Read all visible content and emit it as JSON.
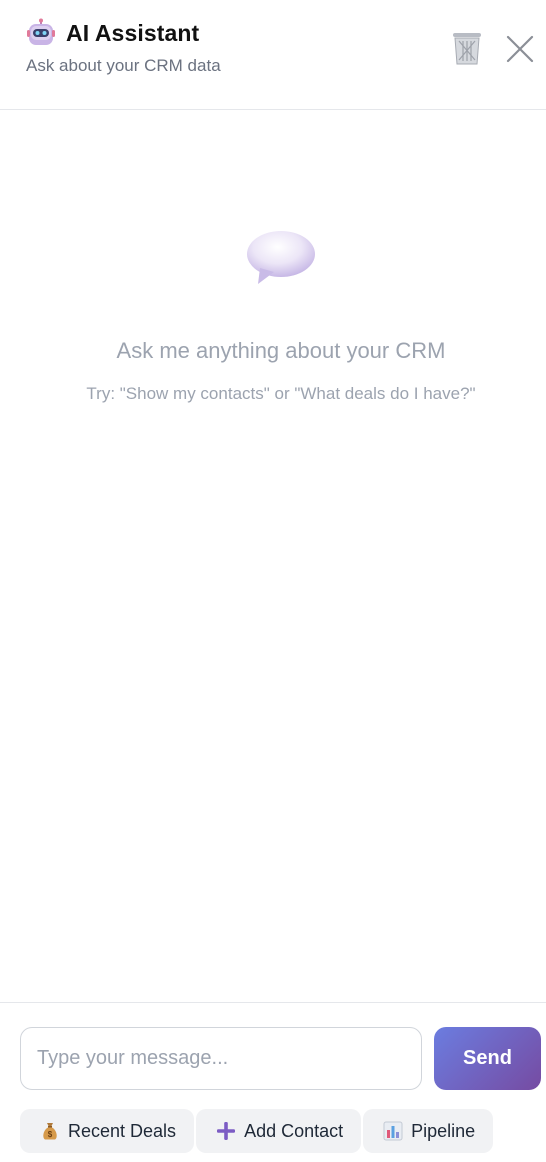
{
  "header": {
    "title": "AI Assistant",
    "subtitle": "Ask about your CRM data",
    "bot_icon": "robot-icon",
    "trash_icon": "wastebasket-icon",
    "close_icon": "close-icon"
  },
  "empty_state": {
    "icon": "speech-bubble-icon",
    "title": "Ask me anything about your CRM",
    "hint": "Try: \"Show my contacts\" or \"What deals do I have?\""
  },
  "composer": {
    "placeholder": "Type your message...",
    "value": "",
    "send_label": "Send"
  },
  "quick_actions": [
    {
      "label": "Recent Deals",
      "icon": "money-bag-icon"
    },
    {
      "label": "Add Contact",
      "icon": "plus-icon"
    },
    {
      "label": "Pipeline",
      "icon": "bar-chart-icon"
    }
  ],
  "colors": {
    "send_gradient_start": "#6b7de0",
    "send_gradient_end": "#764ba2",
    "muted_text": "#9ca3af",
    "plus_icon": "#7c5cc4"
  }
}
